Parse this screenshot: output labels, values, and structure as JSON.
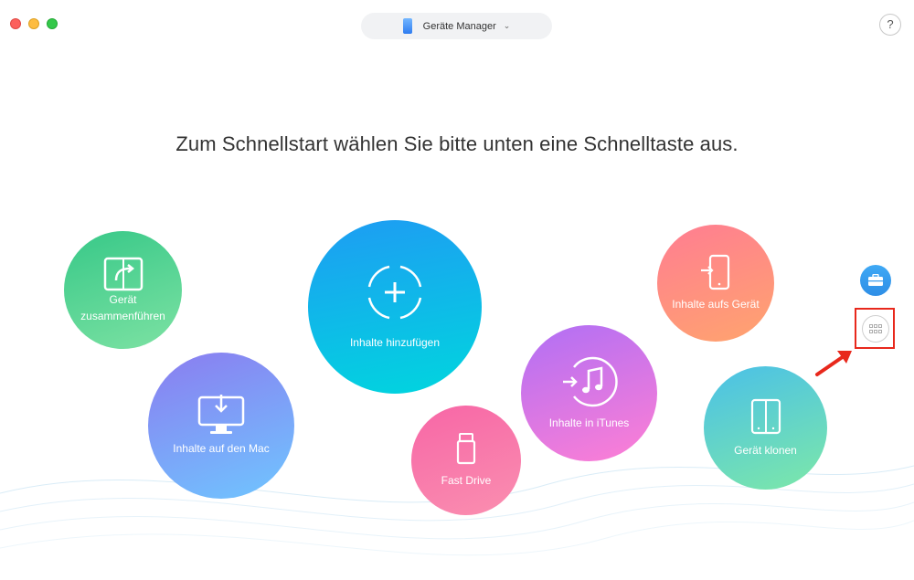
{
  "window": {
    "device_selector": {
      "label": "Geräte Manager",
      "icon": "iphone-icon"
    },
    "help_label": "?"
  },
  "main": {
    "headline": "Zum Schnellstart wählen Sie bitte unten eine Schnelltaste aus.",
    "buttons": [
      {
        "label_line1": "Gerät",
        "label_line2": "zusammenführen",
        "icon": "merge-devices-icon",
        "color": "#37c888"
      },
      {
        "label": "Inhalte auf den Mac",
        "icon": "monitor-download-icon",
        "color": "#7f99f5"
      },
      {
        "label": "Inhalte hinzufügen",
        "icon": "add-circle-icon",
        "color": "#12b6e9"
      },
      {
        "label": "Fast Drive",
        "icon": "usb-drive-icon",
        "color": "#f877a9"
      },
      {
        "label": "Inhalte in iTunes",
        "icon": "itunes-icon",
        "color": "#d577e8"
      },
      {
        "label": "Inhalte aufs Gerät",
        "icon": "phone-import-icon",
        "color": "#ff8e80"
      },
      {
        "label": "Gerät klonen",
        "icon": "clone-device-icon",
        "color": "#5fd4c0"
      }
    ]
  },
  "sidebar": {
    "toolbox_icon": "toolbox-icon",
    "more_icon": "grid-icon",
    "highlight_color": "#e8281c"
  }
}
